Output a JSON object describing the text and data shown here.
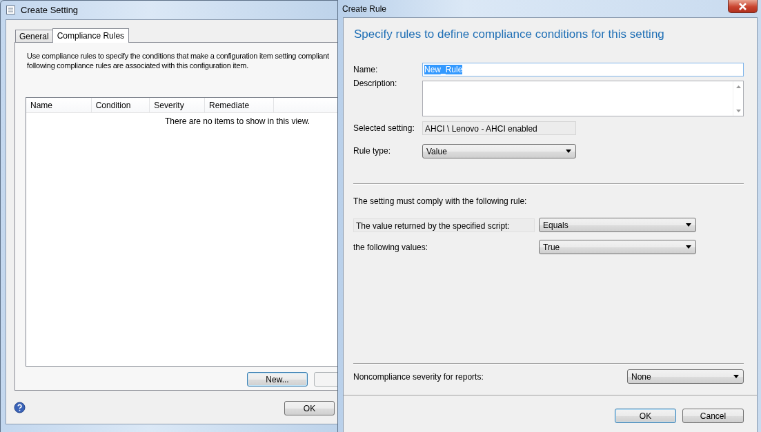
{
  "left_window": {
    "title": "Create Setting",
    "tabs": [
      {
        "label": "General",
        "selected": false
      },
      {
        "label": "Compliance Rules",
        "selected": true
      }
    ],
    "intro": [
      "Use compliance rules to specify the conditions that make a configuration item setting compliant",
      "following compliance rules are associated with this configuration item."
    ],
    "table": {
      "columns": [
        "Name",
        "Condition",
        "Severity",
        "Remediate"
      ],
      "empty_message": "There are no items to show in this view."
    },
    "new_button": {
      "label": "New...",
      "focused": true
    },
    "ok_button": "OK"
  },
  "right_window": {
    "title": "Create Rule",
    "heading": "Specify rules to define compliance conditions for this setting",
    "fields": [
      {
        "kind": "text",
        "label": "Name:",
        "value": "New_Rule",
        "highlighted": true
      },
      {
        "kind": "textarea",
        "label": "Description:"
      },
      {
        "kind": "readonly",
        "label": "Selected setting:",
        "value": "AHCI \\ Lenovo - AHCI enabled"
      },
      {
        "kind": "dropdown",
        "label": "Rule type:",
        "value": "Value"
      }
    ],
    "rule_section": {
      "caption": "The setting must comply with the following rule:",
      "rows": [
        {
          "label": "The value returned by the specified script:",
          "boxed": true,
          "value": "Equals"
        },
        {
          "label": "the following values:",
          "boxed": false,
          "value": "True"
        }
      ]
    },
    "severity": {
      "label": "Noncompliance severity for reports:",
      "value": "None"
    },
    "buttons": [
      {
        "label": "OK",
        "focused": true
      },
      {
        "label": "Cancel",
        "focused": false
      }
    ]
  }
}
